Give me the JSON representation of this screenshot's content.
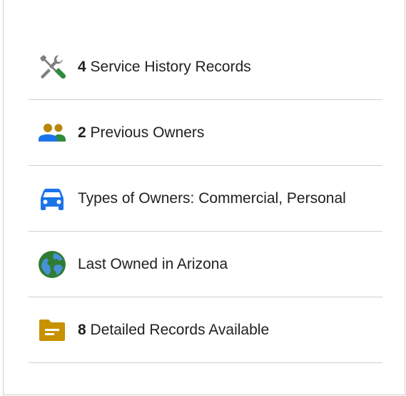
{
  "colors": {
    "tools_gray": "#7f7f7f",
    "tools_green": "#2e8b3a",
    "people_gold": "#b8860b",
    "people_green": "#2e8b3a",
    "people_blue": "#1a73e8",
    "car_blue": "#1a73e8",
    "globe_green": "#2e7d32",
    "globe_blue": "#4a90d9",
    "folder_gold": "#c79100",
    "divider": "#cfcfcf"
  },
  "items": [
    {
      "icon": "tools-icon",
      "count": "4",
      "label": "Service History Records"
    },
    {
      "icon": "owners-icon",
      "count": "2",
      "label": "Previous Owners"
    },
    {
      "icon": "car-icon",
      "count": "",
      "label": "Types of Owners: Commercial, Personal"
    },
    {
      "icon": "globe-icon",
      "count": "",
      "label": "Last Owned in Arizona"
    },
    {
      "icon": "folder-icon",
      "count": "8",
      "label": "Detailed Records Available"
    }
  ]
}
